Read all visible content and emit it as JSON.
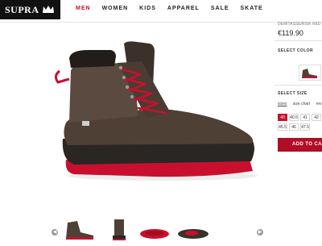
{
  "brand": {
    "logo_text": "SUPRA"
  },
  "nav": {
    "items": [
      "MEN",
      "WOMEN",
      "KIDS",
      "APPAREL",
      "SALE",
      "SKATE"
    ]
  },
  "product": {
    "name": "DEMITASSE/RISK RED",
    "price": "€119.90"
  },
  "color_section": {
    "label": "SELECT COLOR"
  },
  "size_section": {
    "label": "SELECT SIZE",
    "links": [
      "sizes",
      "size chart",
      "rev"
    ],
    "sizes": [
      "40",
      "40.5",
      "41",
      "42",
      "45.5",
      "46",
      "47.5"
    ]
  },
  "cart": {
    "button_label": "ADD TO CART"
  },
  "colors": {
    "accent": "#c8102e",
    "button": "#b10d25",
    "boot": "#5a4a40",
    "sole": "#2a2624"
  }
}
